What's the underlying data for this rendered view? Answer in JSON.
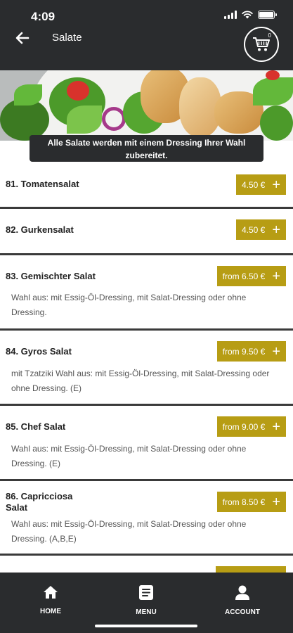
{
  "status_bar": {
    "time": "4:09"
  },
  "header": {
    "title": "Salate",
    "cart_count": "0"
  },
  "banner": {
    "text": "Alle Salate werden mit einem Dressing Ihrer Wahl zubereitet."
  },
  "items": [
    {
      "name": "81. Tomatensalat",
      "price": "4.50 €",
      "description": ""
    },
    {
      "name": "82. Gurkensalat",
      "price": "4.50 €",
      "description": ""
    },
    {
      "name": "83. Gemischter Salat",
      "price": "from 6.50 €",
      "description": "Wahl aus: mit Essig-Öl-Dressing, mit Salat-Dressing oder ohne Dressing."
    },
    {
      "name": "84. Gyros Salat",
      "price": "from 9.50 €",
      "description": "mit Tzatziki Wahl aus: mit Essig-Öl-Dressing, mit Salat-Dressing oder ohne Dressing. (E)"
    },
    {
      "name": "85. Chef Salat",
      "price": "from 9.00 €",
      "description": "Wahl aus: mit Essig-Öl-Dressing, mit Salat-Dressing oder ohne Dressing. (E)"
    },
    {
      "name": "86. Capricciosa Salat",
      "price": "from 8.50 €",
      "description": "Wahl aus: mit Essig-Öl-Dressing, mit Salat-Dressing oder ohne Dressing. (A,B,E)"
    }
  ],
  "bottom_nav": [
    {
      "label": "HOME",
      "icon": "home-icon"
    },
    {
      "label": "MENU",
      "icon": "menu-icon"
    },
    {
      "label": "ACCOUNT",
      "icon": "account-icon"
    }
  ],
  "colors": {
    "bar": "#2a2c2e",
    "accent": "#b79d14",
    "text": "#222222"
  },
  "symbols": {
    "plus": "+"
  }
}
